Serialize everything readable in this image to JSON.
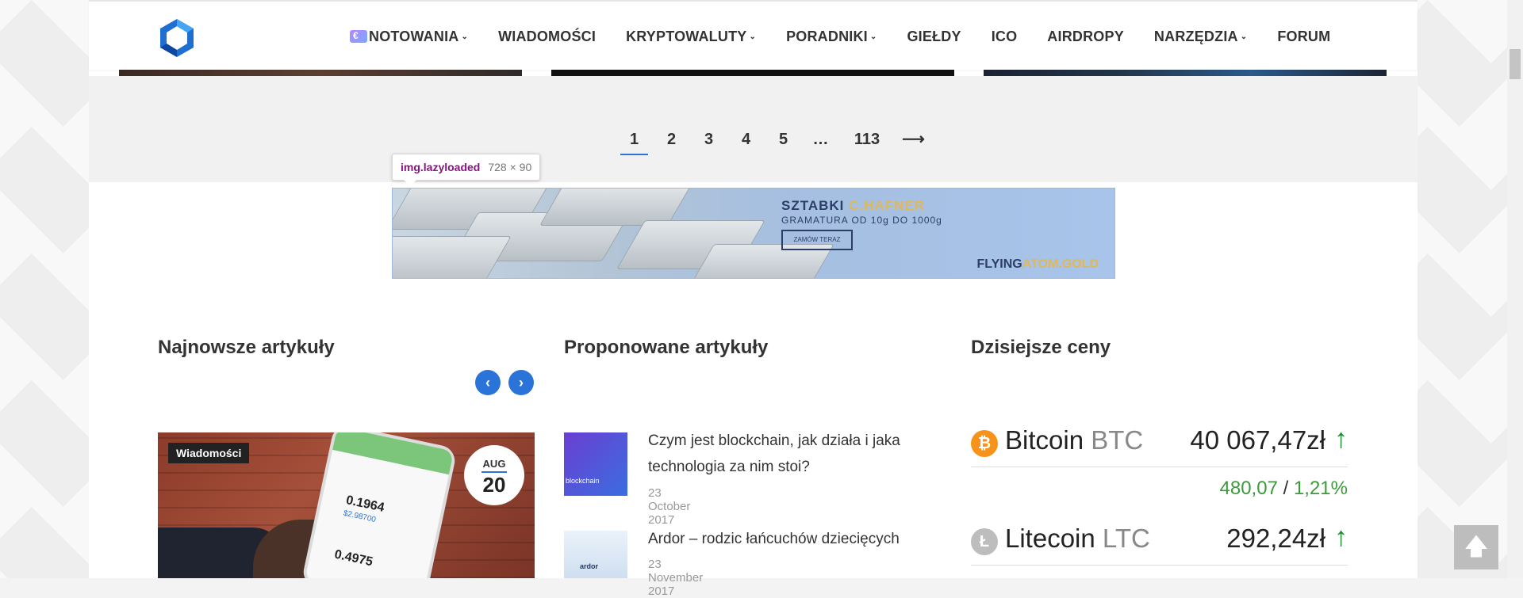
{
  "nav": {
    "items": [
      {
        "label": "NOTOWANIA",
        "dropdown": true,
        "badge": true
      },
      {
        "label": "WIADOMOŚCI",
        "dropdown": false
      },
      {
        "label": "KRYPTOWALUTY",
        "dropdown": true
      },
      {
        "label": "PORADNIKI",
        "dropdown": true
      },
      {
        "label": "GIEŁDY",
        "dropdown": false
      },
      {
        "label": "ICO",
        "dropdown": false
      },
      {
        "label": "AIRDROPY",
        "dropdown": false
      },
      {
        "label": "NARZĘDZIA",
        "dropdown": true
      },
      {
        "label": "FORUM",
        "dropdown": false
      }
    ],
    "chevron": "⌄"
  },
  "pagination": {
    "pages": [
      "1",
      "2",
      "3",
      "4",
      "5",
      "…",
      "113"
    ],
    "active": "1",
    "next": "⟶"
  },
  "tooltip": {
    "tag": "img.lazyloaded",
    "size": "728 × 90"
  },
  "banner": {
    "title_a": "SZTABKI ",
    "title_b": "C.HAFNER",
    "subtitle": "GRAMATURA OD 10g DO 1000g",
    "button": "ZAMÓW TERAZ",
    "brand_a": "FLYING",
    "brand_b": "ATOM.GOLD"
  },
  "sections": {
    "latest": "Najnowsze artykuły",
    "proposed": "Proponowane artykuły",
    "prices": "Dzisiejsze ceny"
  },
  "latest_article": {
    "category": "Wiadomości",
    "month": "AUG",
    "day": "20",
    "phone": {
      "v1": "0.1964",
      "v2": "$2.98700",
      "v3": "0.4975"
    }
  },
  "proposed": [
    {
      "title": "Czym jest blockchain, jak działa i jaka technologia za nim stoi?",
      "date": "23 October 2017",
      "thumb": "blockchain"
    },
    {
      "title": "Ardor – rodzic łańcuchów dziecięcych",
      "date": "23 November 2017",
      "thumb": "ardor"
    }
  ],
  "prices": [
    {
      "name": "Bitcoin",
      "symbol": "BTC",
      "price": "40 067,47zł",
      "change": "480,07",
      "percent": "1,21%",
      "icon": "bitcoin-icon",
      "glyph": "₿",
      "arrow": "↑"
    },
    {
      "name": "Litecoin",
      "symbol": "LTC",
      "price": "292,24zł",
      "icon": "litecoin-icon",
      "glyph": "Ł",
      "arrow": "↑"
    }
  ],
  "colors": {
    "accent": "#2a73d9",
    "up": "#3c9a3c",
    "btc": "#f7931a"
  },
  "to_top": "🡅"
}
